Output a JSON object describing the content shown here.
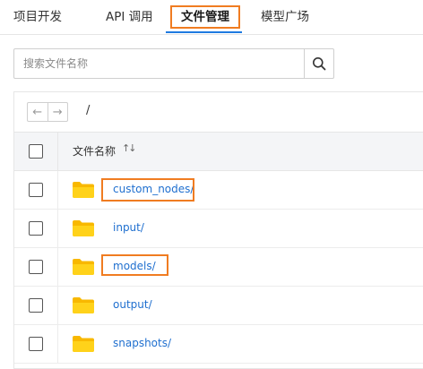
{
  "tabs": [
    {
      "label": "项目开发",
      "active": false
    },
    {
      "label": "API 调用",
      "active": false
    },
    {
      "label": "文件管理",
      "active": true
    },
    {
      "label": "模型广场",
      "active": false
    }
  ],
  "search": {
    "placeholder": "搜索文件名称",
    "icon": "search-icon"
  },
  "path": {
    "back_icon": "←",
    "forward_icon": "→",
    "current": "/"
  },
  "table": {
    "header": {
      "name": "文件名称",
      "sort_icon": "↑↓"
    },
    "rows": [
      {
        "name": "custom_nodes/",
        "type": "folder"
      },
      {
        "name": "input/",
        "type": "folder"
      },
      {
        "name": "models/",
        "type": "folder"
      },
      {
        "name": "output/",
        "type": "folder"
      },
      {
        "name": "snapshots/",
        "type": "folder"
      }
    ]
  },
  "colors": {
    "accent": "#1f7ae0",
    "highlight": "#f07c21",
    "folder": "#ffcc00",
    "link": "#1f6fcf"
  }
}
